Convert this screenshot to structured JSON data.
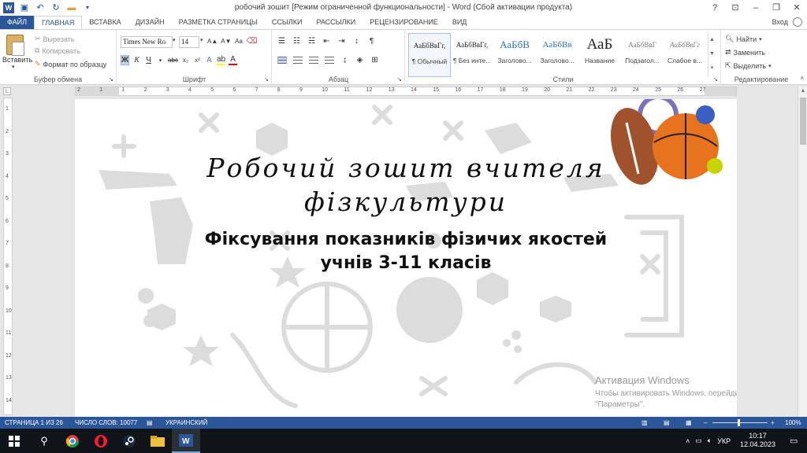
{
  "titlebar": {
    "doc_title": "робочий зошит [Режим ограниченной функциональности] - Word (Сбой активации продукта)",
    "help": "?",
    "minimize": "–",
    "restore": "❐",
    "close": "✕"
  },
  "tabs": [
    {
      "label": "ФАЙЛ"
    },
    {
      "label": "ГЛАВНАЯ"
    },
    {
      "label": "ВСТАВКА"
    },
    {
      "label": "ДИЗАЙН"
    },
    {
      "label": "РАЗМЕТКА СТРАНИЦЫ"
    },
    {
      "label": "ССЫЛКИ"
    },
    {
      "label": "РАССЫЛКИ"
    },
    {
      "label": "РЕЦЕНЗИРОВАНИЕ"
    },
    {
      "label": "ВИД"
    }
  ],
  "signin": "Вход",
  "clipboard": {
    "paste": "Вставить",
    "cut": "Вырезать",
    "copy": "Копировать",
    "format_painter": "Формат по образцу",
    "label": "Буфер обмена"
  },
  "font": {
    "name": "Times New Ro",
    "size": "14",
    "bold": "Ж",
    "italic": "К",
    "underline": "Ч",
    "strike": "abc",
    "sub": "x₂",
    "sup": "x²",
    "grow": "A▲",
    "shrink": "A▼",
    "case": "Aa",
    "label": "Шрифт"
  },
  "paragraph": {
    "label": "Абзац",
    "pilcrow": "¶"
  },
  "styles": {
    "label": "Стили",
    "items": [
      {
        "sample": "АаБбВвГг,",
        "name": "¶ Обычный"
      },
      {
        "sample": "АаБбВвГг,",
        "name": "¶ Без инте..."
      },
      {
        "sample": "АаБбВ",
        "name": "Заголово..."
      },
      {
        "sample": "АаБбВв",
        "name": "Заголово..."
      },
      {
        "sample": "АаБ",
        "name": "Название"
      },
      {
        "sample": "АаБбВвГ",
        "name": "Подзагол..."
      },
      {
        "sample": "АаБбВвГг",
        "name": "Слабое в..."
      }
    ]
  },
  "editing": {
    "find": "Найти",
    "replace": "Заменить",
    "select": "Выделить",
    "label": "Редактирование"
  },
  "ruler": {
    "h_numbers": [
      "2",
      "1",
      "1",
      "2",
      "3",
      "4",
      "5",
      "6",
      "7",
      "8",
      "9",
      "10",
      "11",
      "12",
      "13",
      "14",
      "15",
      "16",
      "17",
      "18",
      "19",
      "20",
      "21",
      "22",
      "23",
      "24",
      "25",
      "26",
      "27"
    ],
    "v_numbers": [
      "1",
      "2",
      "3",
      "4",
      "5",
      "6",
      "7",
      "8",
      "9",
      "10",
      "11",
      "12",
      "13",
      "14"
    ],
    "corner": "L"
  },
  "document": {
    "heading_line1": "Робочий зошит вчителя",
    "heading_line2": "фізкультури",
    "subtitle_line1": "Фіксування показників фізичих якостей",
    "subtitle_line2": "учнів 3-11 класів"
  },
  "activation": {
    "title": "Активация Windows",
    "text": "Чтобы активировать Windows, перейдите в раздел \"Параметры\"."
  },
  "statusbar": {
    "page": "СТРАНИЦА 1 ИЗ 26",
    "words": "ЧИСЛО СЛОВ: 10077",
    "language": "УКРАИНСКИЙ",
    "zoom": "100%",
    "zoom_level": 1.0
  },
  "taskbar": {
    "language": "УКР",
    "time": "10:17",
    "date": "12.04.2023"
  },
  "colors": {
    "word_blue": "#2b579a",
    "taskbar": "#101418"
  }
}
